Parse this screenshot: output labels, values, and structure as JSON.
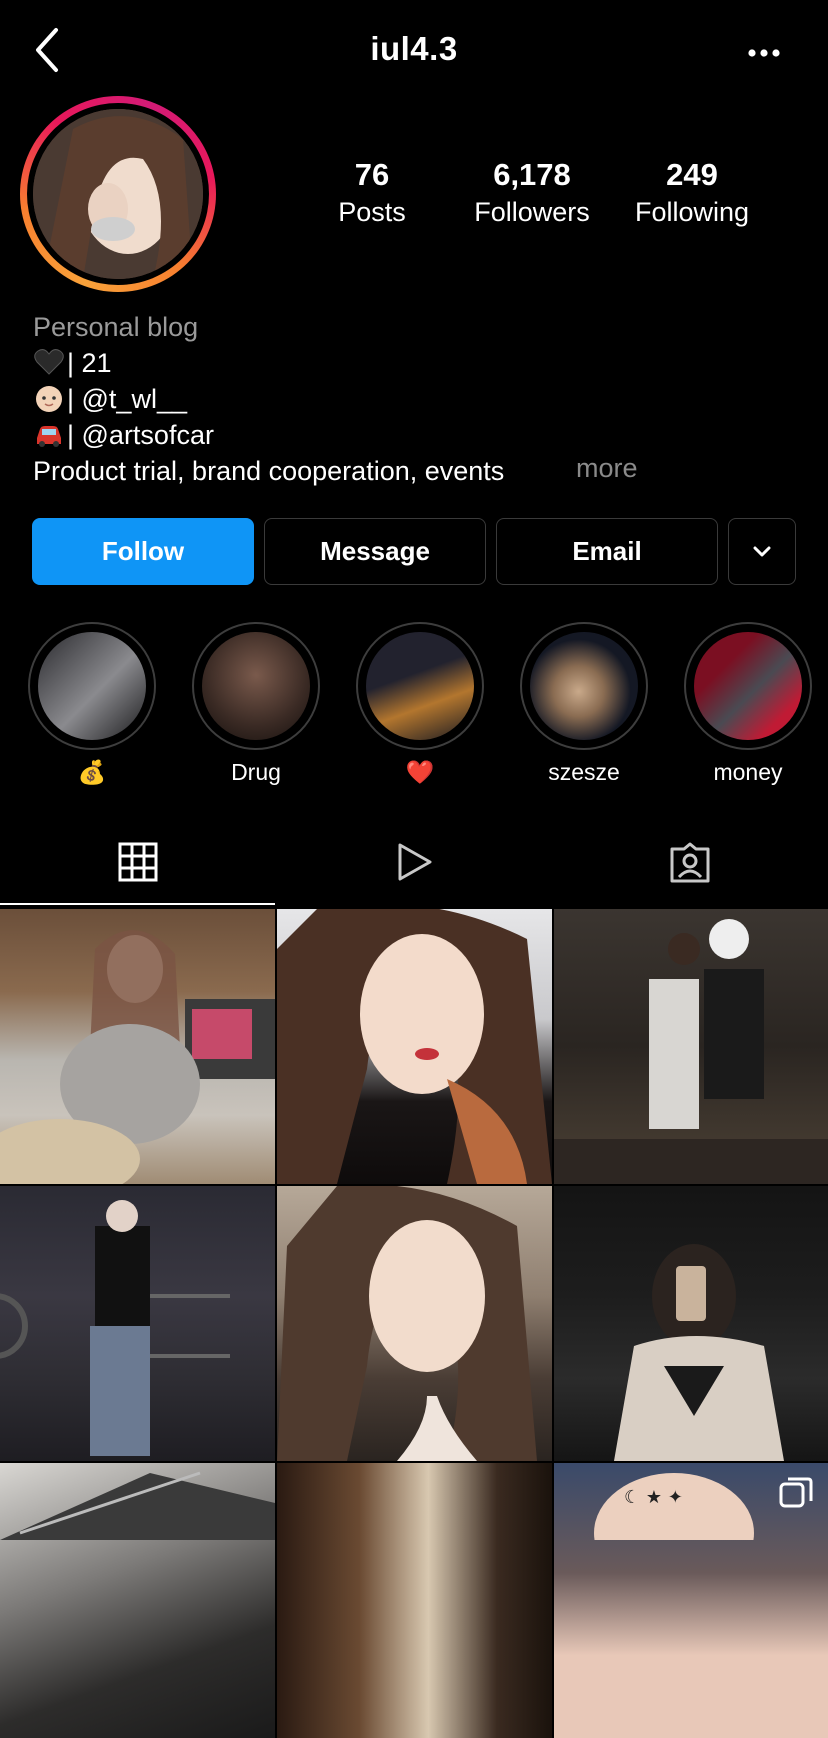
{
  "header": {
    "username": "iul4.3"
  },
  "stats": {
    "posts": {
      "value": "76",
      "label": "Posts"
    },
    "followers": {
      "value": "6,178",
      "label": "Followers"
    },
    "following": {
      "value": "249",
      "label": "Following"
    }
  },
  "bio": {
    "category": "Personal blog",
    "lines": [
      "| 21",
      "| @t_wl__",
      "| @artsofcar"
    ],
    "description": "Product trial, brand cooperation, events",
    "more": "more"
  },
  "actions": {
    "follow": "Follow",
    "message": "Message",
    "email": "Email"
  },
  "highlights": [
    {
      "label": "💰"
    },
    {
      "label": "Drug"
    },
    {
      "label": "❤️"
    },
    {
      "label": "szesze"
    },
    {
      "label": "money"
    }
  ],
  "tabs": [
    {
      "icon": "grid-icon",
      "active": true
    },
    {
      "icon": "reels-icon",
      "active": false
    },
    {
      "icon": "tagged-icon",
      "active": false
    }
  ],
  "colors": {
    "accent": "#0f95f6",
    "background": "#000000",
    "muted": "#9a9a9a"
  }
}
